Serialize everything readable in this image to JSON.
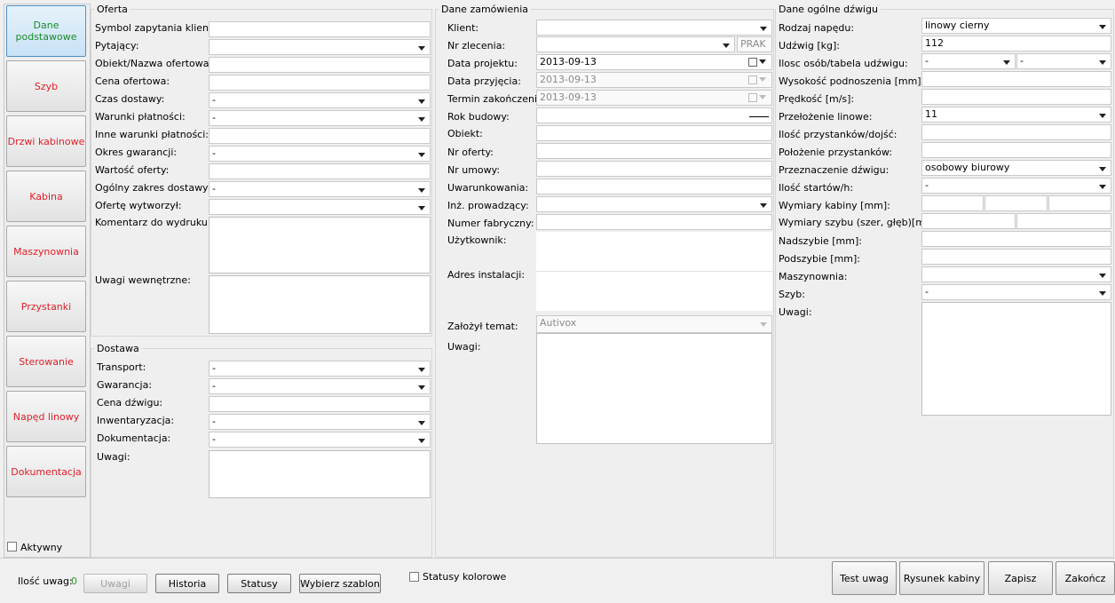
{
  "sidebar": {
    "items": [
      {
        "label": "Dane podstawowe",
        "active": true
      },
      {
        "label": "Szyb"
      },
      {
        "label": "Drzwi kabinowe"
      },
      {
        "label": "Kabina"
      },
      {
        "label": "Maszynownia"
      },
      {
        "label": "Przystanki"
      },
      {
        "label": "Sterowanie"
      },
      {
        "label": "Napęd linowy"
      },
      {
        "label": "Dokumentacja"
      }
    ],
    "active_checkbox_label": "Aktywny"
  },
  "oferta": {
    "title": "Oferta",
    "symbol_label": "Symbol zapytania klienta:",
    "symbol_value": "",
    "pytajacy_label": "Pytający:",
    "pytajacy_value": "",
    "obiekt_label": "Obiekt/Nazwa ofertowa:",
    "obiekt_value": "",
    "cena_label": "Cena ofertowa:",
    "cena_value": "",
    "czas_label": "Czas dostawy:",
    "czas_value": "-",
    "warunki_label": "Warunki płatności:",
    "warunki_value": "-",
    "inne_label": "Inne warunki płatności:",
    "inne_value": "",
    "okres_label": "Okres gwarancji:",
    "okres_value": "-",
    "wartosc_label": "Wartość oferty:",
    "wartosc_value": "",
    "zakres_label": "Ogólny zakres dostawy:",
    "zakres_value": "-",
    "wytworzyl_label": "Ofertę wytworzył:",
    "wytworzyl_value": "",
    "komentarz_label": "Komentarz do wydruku:",
    "uwagi_wew_label": "Uwagi wewnętrzne:"
  },
  "dostawa": {
    "title": "Dostawa",
    "transport_label": "Transport:",
    "transport_value": "-",
    "gwarancja_label": "Gwarancja:",
    "gwarancja_value": "-",
    "cena_label": "Cena dźwigu:",
    "cena_value": "",
    "inwent_label": "Inwentaryzacja:",
    "inwent_value": "-",
    "dokumentacja_label": "Dokumentacja:",
    "dokumentacja_value": "-",
    "uwagi_label": "Uwagi:"
  },
  "zamowienie": {
    "title": "Dane zamówienia",
    "klient_label": "Klient:",
    "klient_value": "",
    "nr_zlecenia_label": "Nr zlecenia:",
    "nr_zlecenia_value": "",
    "prak_placeholder": "PRAK",
    "data_projektu_label": "Data projektu:",
    "data_projektu_value": "2013-09-13",
    "data_przyjecia_label": "Data przyjęcia:",
    "data_przyjecia_value": "2013-09-13",
    "termin_label": "Termin zakończenia:",
    "termin_value": "2013-09-13",
    "rok_label": "Rok budowy:",
    "rok_value": "",
    "obiekt_label": "Obiekt:",
    "obiekt_value": "",
    "nr_oferty_label": "Nr oferty:",
    "nr_oferty_value": "",
    "nr_umowy_label": "Nr umowy:",
    "nr_umowy_value": "",
    "uwarunk_label": "Uwarunkowania:",
    "uwarunk_value": "",
    "inz_label": "Inż. prowadzący:",
    "inz_value": "",
    "numer_fab_label": "Numer fabryczny:",
    "numer_fab_value": "",
    "uzytkownik_label": "Użytkownik:",
    "adres_label": "Adres instalacji:",
    "zalozyl_label": "Założył temat:",
    "zalozyl_value": "Autivox",
    "uwagi_label": "Uwagi:"
  },
  "dzwig": {
    "title": "Dane ogólne dźwigu",
    "rodzaj_label": "Rodzaj napędu:",
    "rodzaj_value": "linowy cierny",
    "udzwig_label": "Udźwig [kg]:",
    "udzwig_value": "112",
    "ilosc_osob_label": "Ilosc osób/tabela udźwigu:",
    "ilosc_osob_value1": "-",
    "ilosc_osob_value2": "-",
    "wysokosc_label": "Wysokość podnoszenia [mm]:",
    "wysokosc_value": "",
    "predkosc_label": "Prędkość [m/s]:",
    "predkosc_value": "",
    "przelozenie_label": "Przełożenie linowe:",
    "przelozenie_value": "11",
    "ilosc_przyst_label": "Ilość przystanków/dojść:",
    "ilosc_przyst_value": "",
    "polozenie_label": "Położenie przystanków:",
    "polozenie_value": "",
    "przeznaczenie_label": "Przeznaczenie dźwigu:",
    "przeznaczenie_value": "osobowy biurowy",
    "startow_label": "Ilość startów/h:",
    "startow_value": "-",
    "wym_kabiny_label": "Wymiary kabiny [mm]:",
    "wym_szybu_label": "Wymiary szybu (szer, głęb)[mm]:",
    "nadszybie_label": "Nadszybie [mm]:",
    "nadszybie_value": "",
    "podszybie_label": "Podszybie [mm]:",
    "podszybie_value": "",
    "maszynownia_label": "Maszynownia:",
    "maszynownia_value": "",
    "szyb_label": "Szyb:",
    "szyb_value": "-",
    "uwagi_label": "Uwagi:"
  },
  "footer": {
    "ilosc_uwag_label": "Ilość uwag:",
    "ilosc_uwag_value": "0",
    "uwagi_btn": "Uwagi",
    "historia_btn": "Historia",
    "statusy_btn": "Statusy",
    "szablon_btn": "Wybierz szablon",
    "statusy_kolorowe_label": "Statusy kolorowe",
    "test_uwag_btn": "Test uwag",
    "rysunek_btn": "Rysunek kabiny",
    "zapisz_btn": "Zapisz",
    "zakoncz_btn": "Zakończ"
  },
  "colors": {
    "nav_text": "#e0202a",
    "nav_active_text": "#1a8a2a",
    "nav_active_bg": "#c8e2f6",
    "count_green": "#2a9a2a"
  }
}
